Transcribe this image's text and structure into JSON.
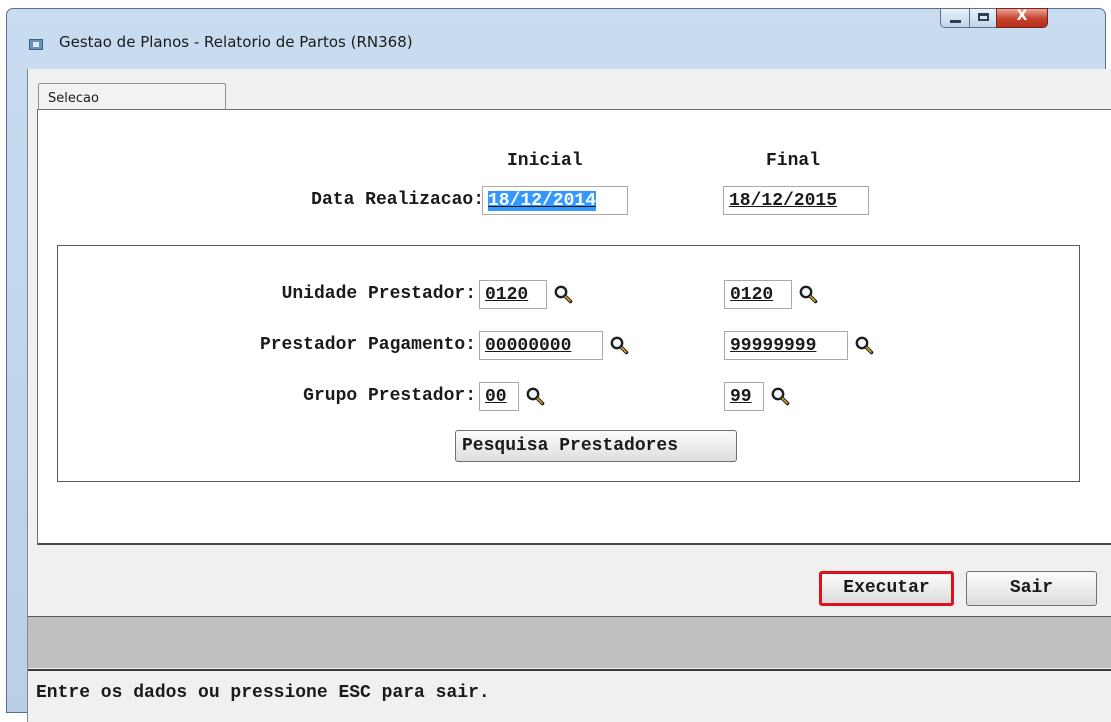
{
  "window": {
    "title": "Gestao de Planos - Relatorio de Partos (RN368)",
    "close_glyph": "X"
  },
  "tab": {
    "label": "Selecao"
  },
  "headers": {
    "inicial": "Inicial",
    "final": "Final"
  },
  "data_realizacao": {
    "label": "Data Realizacao:",
    "inicial": "18/12/2014",
    "final": "18/12/2015"
  },
  "unidade_prestador": {
    "label": "Unidade Prestador:",
    "inicial": "0120",
    "final": "0120"
  },
  "prestador_pagamento": {
    "label": "Prestador Pagamento:",
    "inicial": "00000000",
    "final": "99999999"
  },
  "grupo_prestador": {
    "label": "Grupo Prestador:",
    "inicial": "00",
    "final": "99"
  },
  "buttons": {
    "pesquisa": "Pesquisa Prestadores",
    "executar": "Executar",
    "sair": "Sair"
  },
  "status": {
    "text": "Entre os dados ou pressione ESC para sair."
  },
  "colors": {
    "highlight": "#e0101e",
    "selection": "#3399ff",
    "message_bar": "#c0c0c0"
  },
  "icons": [
    "app-icon",
    "search-icon"
  ]
}
